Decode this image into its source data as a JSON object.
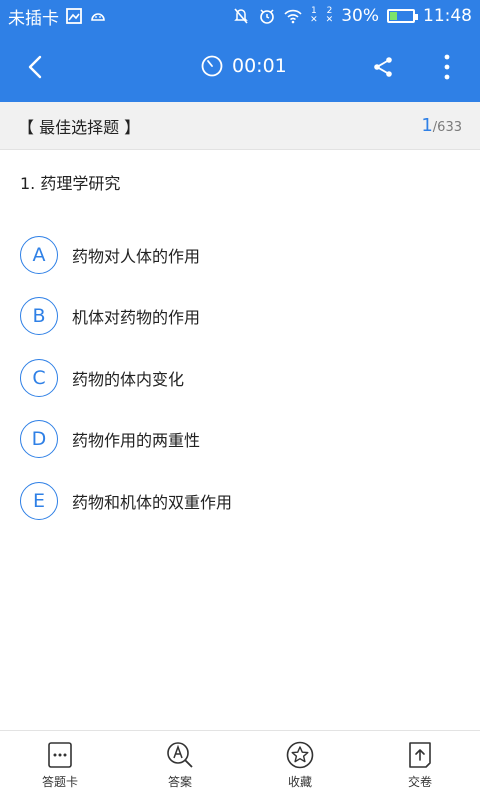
{
  "status_bar": {
    "carrier": "未插卡",
    "sim1": "1",
    "sim2": "2",
    "battery_percent": "30%",
    "battery_level": 0.3,
    "time": "11:48",
    "icons": [
      "image-icon",
      "android-icon",
      "mute-icon",
      "alarm-icon",
      "wifi-icon",
      "signal-icon",
      "battery-icon"
    ]
  },
  "app_bar": {
    "timer": "00:01",
    "icons": [
      "back-icon",
      "timer-icon",
      "share-icon",
      "more-icon"
    ]
  },
  "section": {
    "title": "【 最佳选择题 】",
    "current": "1",
    "total": "/633"
  },
  "question": {
    "text": "1. 药理学研究"
  },
  "options": [
    {
      "letter": "A",
      "text": "药物对人体的作用"
    },
    {
      "letter": "B",
      "text": "机体对药物的作用"
    },
    {
      "letter": "C",
      "text": "药物的体内变化"
    },
    {
      "letter": "D",
      "text": "药物作用的两重性"
    },
    {
      "letter": "E",
      "text": "药物和机体的双重作用"
    }
  ],
  "bottom_bar": {
    "items": [
      {
        "label": "答题卡",
        "icon": "answer-sheet-icon"
      },
      {
        "label": "答案",
        "icon": "answer-search-icon"
      },
      {
        "label": "收藏",
        "icon": "star-icon"
      },
      {
        "label": "交卷",
        "icon": "submit-icon"
      }
    ]
  },
  "colors": {
    "primary": "#2f80e6",
    "section_bg": "#f1f1f1",
    "text": "#222222"
  }
}
